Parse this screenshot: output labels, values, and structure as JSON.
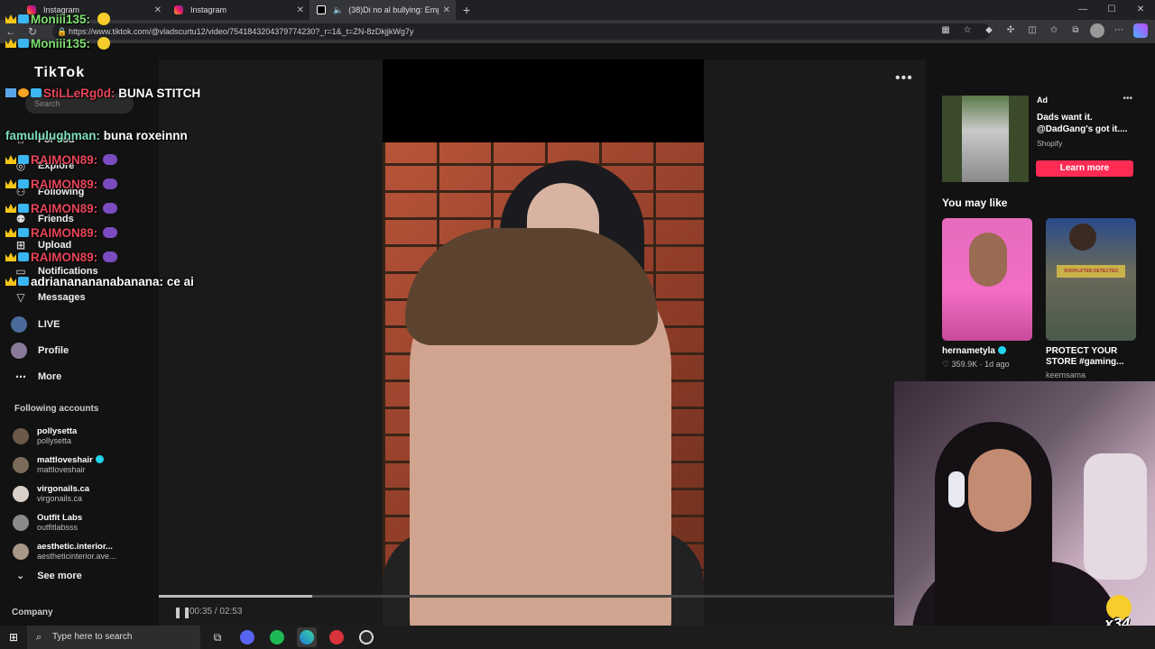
{
  "browser": {
    "tabs": [
      {
        "title": "Instagram",
        "icon": "instagram-icon"
      },
      {
        "title": "Instagram",
        "icon": "instagram-icon"
      },
      {
        "title": "(38)Di no al bullying: Empo",
        "icon": "tiktok-icon"
      }
    ],
    "url": "https://www.tiktok.com/@vladscurtu12/video/7541843204379774230?_r=1&_t=ZN-8zDkjjkWg7y"
  },
  "tiktok": {
    "logo": "TikTok",
    "search_placeholder": "Search",
    "nav": [
      {
        "label": "For You",
        "icon": "home-icon"
      },
      {
        "label": "Explore",
        "icon": "compass-icon"
      },
      {
        "label": "Following",
        "icon": "following-icon"
      },
      {
        "label": "Friends",
        "icon": "friends-icon"
      },
      {
        "label": "Upload",
        "icon": "upload-icon"
      },
      {
        "label": "Notifications",
        "icon": "bell-icon"
      },
      {
        "label": "Messages",
        "icon": "message-icon"
      },
      {
        "label": "LIVE",
        "icon": "live-icon"
      },
      {
        "label": "Profile",
        "icon": "profile-icon"
      },
      {
        "label": "More",
        "icon": "more-icon"
      }
    ],
    "following_title": "Following accounts",
    "following": [
      {
        "name": "pollysetta",
        "user": "pollysetta",
        "verified": false,
        "color": "#6b5a4a"
      },
      {
        "name": "mattloveshair",
        "user": "mattloveshair",
        "verified": true,
        "color": "#7a6a5a"
      },
      {
        "name": "virgonails.ca",
        "user": "virgonails.ca",
        "verified": false,
        "color": "#d8d0c8"
      },
      {
        "name": "Outfit Labs",
        "user": "outfitlabsss",
        "verified": false,
        "color": "#8a8a8a"
      },
      {
        "name": "aesthetic.interior...",
        "user": "aestheticinterior.ave...",
        "verified": false,
        "color": "#a89888"
      }
    ],
    "see_more": "See more",
    "company": "Company",
    "video": {
      "time": "00:35 / 02:53",
      "progress": 0.2
    },
    "ad": {
      "label": "Ad",
      "text": "Dads want it. @DadGang's got it....",
      "brand": "Shopify",
      "cta": "Learn more"
    },
    "you_may_like": "You may like",
    "cards": [
      {
        "caption": "hernametyla",
        "verified": true,
        "meta": "359.9K · 1d ago",
        "sub": ""
      },
      {
        "caption": "PROTECT YOUR STORE #gaming...",
        "verified": false,
        "meta": "",
        "sub": "keemsama",
        "sign": "SHOPLIFTER DETECTED"
      }
    ]
  },
  "chat": [
    {
      "user": "Moniii135:",
      "msg": "",
      "color": "#7ee06f",
      "emoji": "yellow"
    },
    {
      "user": "Moniii135:",
      "msg": "",
      "color": "#7ee06f",
      "emoji": "yellow"
    },
    {
      "user": "StiLLeRg0d:",
      "msg": "BUNA STITCH",
      "color": "#e8455a",
      "emoji": ""
    },
    {
      "user": "famululughman:",
      "msg": "buna roxeinnn",
      "color": "#7ee0b8",
      "emoji": ""
    },
    {
      "user": "RAIMON89:",
      "msg": "",
      "color": "#e8455a",
      "emoji": "purple"
    },
    {
      "user": "RAIMON89:",
      "msg": "",
      "color": "#e8455a",
      "emoji": "purple"
    },
    {
      "user": "RAIMON89:",
      "msg": "",
      "color": "#e8455a",
      "emoji": "purple"
    },
    {
      "user": "RAIMON89:",
      "msg": "",
      "color": "#e8455a",
      "emoji": "purple"
    },
    {
      "user": "RAIMON89:",
      "msg": "",
      "color": "#e8455a",
      "emoji": "purple"
    },
    {
      "user": "adriananananabanana:",
      "msg": "ce ai",
      "color": "#ffffff",
      "emoji": ""
    }
  ],
  "combo": "x34",
  "taskbar": {
    "search_placeholder": "Type here to search",
    "apps": [
      "task-view-icon",
      "discord-icon",
      "spotify-icon",
      "edge-icon",
      "game-app-icon",
      "obs-icon"
    ]
  }
}
